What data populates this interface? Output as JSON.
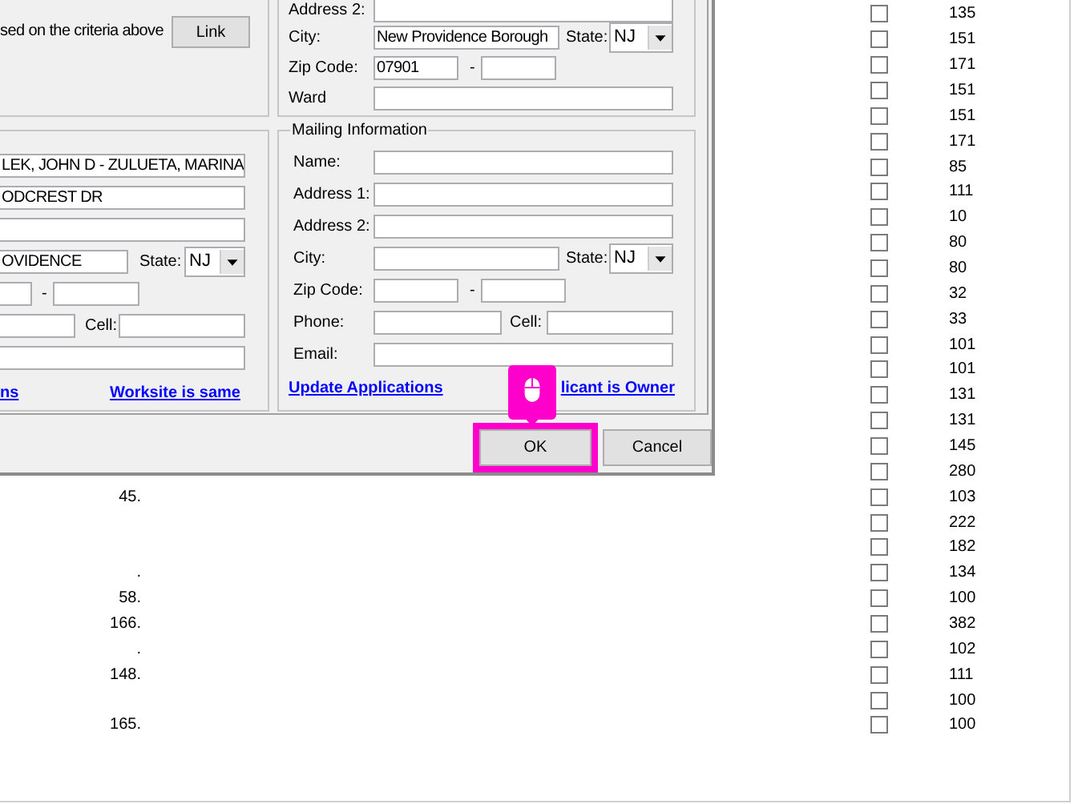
{
  "dialog": {
    "criteria_group": {
      "text": "sed on the criteria above",
      "button": "Link"
    },
    "site_info": {
      "rows": [
        {
          "kind": "text",
          "label": "Address 2:"
        },
        {
          "kind": "city",
          "label": "City:",
          "value": "New Providence Borough",
          "state_label": "State:",
          "state": "NJ"
        },
        {
          "kind": "zip",
          "label": "Zip Code:",
          "value": "07901",
          "separator": "-"
        },
        {
          "kind": "text",
          "label": "Ward"
        }
      ]
    },
    "owner_info": {
      "rows": [
        {
          "kind": "text",
          "value": "LEK, JOHN D - ZULUETA, MARINA"
        },
        {
          "kind": "text",
          "value": "ODCREST DR"
        },
        {
          "kind": "text"
        },
        {
          "kind": "city",
          "value": "OVIDENCE",
          "state_label": "State:",
          "state": "NJ"
        },
        {
          "kind": "zip",
          "separator": "-"
        },
        {
          "kind": "phone",
          "cell_label": "Cell:"
        },
        {
          "kind": "text"
        }
      ],
      "links": [
        "ns",
        "Worksite is same"
      ]
    },
    "mailing_info": {
      "title": "Mailing Information",
      "rows": [
        {
          "kind": "text",
          "label": "Name:"
        },
        {
          "kind": "text",
          "label": "Address 1:"
        },
        {
          "kind": "text",
          "label": "Address 2:"
        },
        {
          "kind": "city",
          "label": "City:",
          "state_label": "State:",
          "state": "NJ"
        },
        {
          "kind": "zip",
          "label": "Zip Code:",
          "separator": "-"
        },
        {
          "kind": "phone",
          "label": "Phone:",
          "cell_label": "Cell:"
        },
        {
          "kind": "text",
          "label": "Email:"
        }
      ],
      "links": [
        "Update Applications",
        "licant is Owner"
      ]
    },
    "buttons": [
      {
        "label": "OK",
        "highlighted": true
      },
      {
        "label": "Cancel",
        "highlighted": false
      }
    ]
  },
  "sheet": {
    "rows": [
      {
        "checked": false,
        "value": "135"
      },
      {
        "checked": false,
        "value": "151"
      },
      {
        "checked": false,
        "value": "171"
      },
      {
        "checked": false,
        "value": "151"
      },
      {
        "checked": false,
        "value": "151"
      },
      {
        "checked": false,
        "value": "171"
      },
      {
        "checked": false,
        "value": "85"
      },
      {
        "checked": false,
        "value": "111"
      },
      {
        "checked": false,
        "value": "10"
      },
      {
        "checked": false,
        "value": "80"
      },
      {
        "checked": false,
        "value": "80"
      },
      {
        "checked": false,
        "value": "32"
      },
      {
        "checked": false,
        "value": "33"
      },
      {
        "checked": false,
        "value": "101"
      },
      {
        "checked": false,
        "value": "101"
      },
      {
        "checked": false,
        "value": "131"
      },
      {
        "checked": false,
        "value": "131"
      },
      {
        "checked": false,
        "value": "145"
      },
      {
        "checked": false,
        "value": "280"
      },
      {
        "column_1": "45.",
        "checked": false,
        "value": "103"
      },
      {
        "checked": false,
        "value": "222"
      },
      {
        "checked": false,
        "value": "182"
      },
      {
        "column_1": ".",
        "checked": false,
        "value": "134"
      },
      {
        "column_1": "58.",
        "checked": false,
        "value": "100"
      },
      {
        "column_1": "166.",
        "checked": false,
        "value": "382"
      },
      {
        "column_1": ".",
        "checked": false,
        "value": "102"
      },
      {
        "column_1": "148.",
        "checked": false,
        "value": "111"
      },
      {
        "checked": false,
        "value": "100"
      },
      {
        "column_1": "165.",
        "checked": false,
        "value": "100"
      }
    ]
  }
}
